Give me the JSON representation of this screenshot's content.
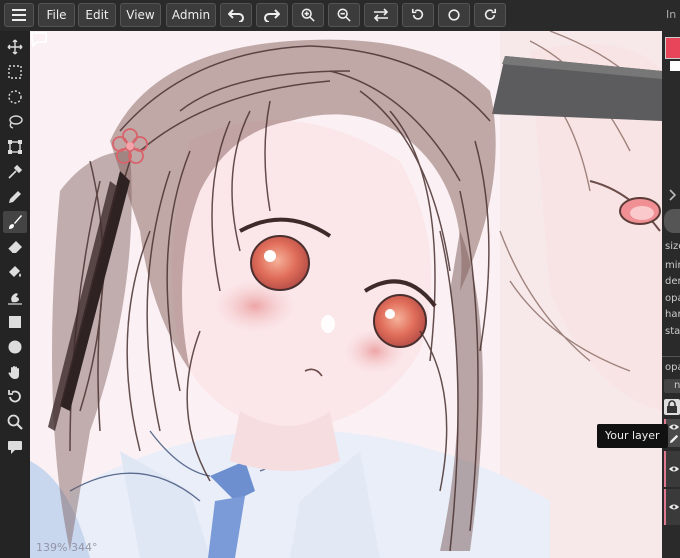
{
  "menu": {
    "file_label": "File",
    "edit_label": "Edit",
    "view_label": "View",
    "admin_label": "Admin"
  },
  "corner_label": "In",
  "canvas": {
    "zoom_readout": "139% 344°"
  },
  "right_panel": {
    "primary_color": "#e8455b",
    "secondary_color": "#ffffff",
    "brush_settings": [
      "size",
      "min",
      "den",
      "opa",
      "harc",
      "stab"
    ],
    "layer_label": "opa",
    "layer_button_label": "n"
  },
  "tooltip": {
    "text": "Your layer"
  },
  "icons": {
    "toolbar": [
      "menu-icon",
      "undo-icon",
      "redo-icon",
      "zoom-in-icon",
      "zoom-out-icon",
      "flip-icon",
      "rotate-left-icon",
      "reset-rotation-icon",
      "rotate-right-icon"
    ],
    "tools": [
      "move-icon",
      "rect-select-icon",
      "ellipse-select-icon",
      "lasso-icon",
      "transform-icon",
      "eyedropper-icon",
      "pen-icon",
      "brush-icon",
      "eraser-icon",
      "fill-icon",
      "smudge-icon",
      "rectangle-icon",
      "circle-icon",
      "hand-icon",
      "rotate-icon",
      "zoom-icon",
      "chat-icon"
    ]
  }
}
